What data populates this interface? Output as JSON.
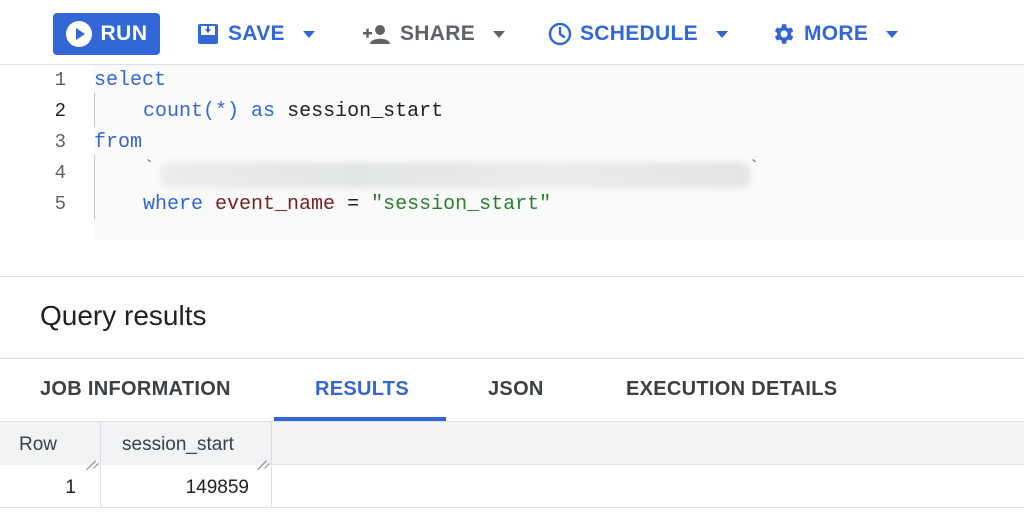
{
  "toolbar": {
    "run_label": "RUN",
    "save_label": "SAVE",
    "share_label": "SHARE",
    "schedule_label": "SCHEDULE",
    "more_label": "MORE",
    "colors": {
      "primary": "#3367d6",
      "disabled": "#5f6368"
    }
  },
  "editor": {
    "line_numbers": [
      "1",
      "2",
      "3",
      "4",
      "5"
    ],
    "active_line": "2",
    "lines": {
      "l1_kw": "select",
      "l2_fn": "count(*)",
      "l2_kw": "as",
      "l2_alias": "session_start",
      "l3_kw": "from",
      "l4_open": "`",
      "l4_close": "`",
      "l5_kw": "where",
      "l5_ident": "event_name",
      "l5_op": "=",
      "l5_str": "\"session_start\""
    }
  },
  "results": {
    "title": "Query results",
    "tabs": [
      "JOB INFORMATION",
      "RESULTS",
      "JSON",
      "EXECUTION DETAILS"
    ],
    "active_tab": "RESULTS",
    "table": {
      "headers": [
        "Row",
        "session_start"
      ],
      "rows": [
        [
          "1",
          "149859"
        ]
      ]
    }
  }
}
